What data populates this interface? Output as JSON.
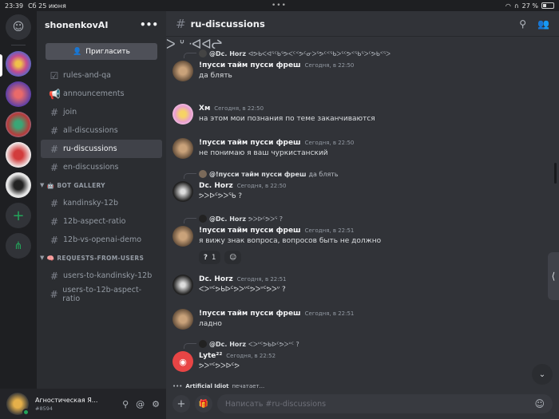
{
  "status": {
    "time": "23:39",
    "date": "Сб 25 июня",
    "battery": "27 %"
  },
  "server": {
    "name": "shonenkovAI",
    "invite_label": "Пригласить"
  },
  "channels": [
    {
      "name": "rules-and-qa",
      "icon": "rules-icon"
    },
    {
      "name": "announcements",
      "icon": "megaphone-icon"
    },
    {
      "name": "join",
      "icon": "hash-icon"
    },
    {
      "name": "all-discussions",
      "icon": "hash-icon"
    },
    {
      "name": "ru-discussions",
      "icon": "hash-icon",
      "active": true
    },
    {
      "name": "en-discussions",
      "icon": "hash-icon"
    }
  ],
  "categories": [
    {
      "name": "BOT GALLERY",
      "channels": [
        "kandinsky-12b",
        "12b-aspect-ratio",
        "12b-vs-openai-demo"
      ]
    },
    {
      "name": "REQUESTS-FROM-USERS",
      "channels": [
        "users-to-kandinsky-12b",
        "users-to-12b-aspect-ratio"
      ]
    }
  ],
  "user": {
    "name": "Агностическая Я...",
    "tag": "#8594"
  },
  "header": {
    "channel": "ru-discussions"
  },
  "messages": {
    "top_fragment": "ᐳ ᐡ ᐧᐊᐊᖠ",
    "m1": {
      "reply_name": "@Dc. Horz",
      "reply_text": "ᐊᕗᑲᐸᐊᕐᑦᑲᕐᕗᐸᑦᑉᕗᑦᓂᐳᕐᕗᑦᑉᕐᑲᐳᕐᑦᕗᑉᕐᑲᕐᐳᑦᕗᑲᑉᕐᐳ",
      "author": "!пусси тайм пусси фреш",
      "time": "Сегодня, в 22:50",
      "text": "да блять"
    },
    "m2": {
      "author": "Хм",
      "time": "Сегодня, в 22:50",
      "text": "на этом мои познания по теме  заканчиваются"
    },
    "m3": {
      "author": "!пусси тайм пусси фреш",
      "time": "Сегодня, в 22:50",
      "text": "не понимаю я ваш чуркистанский"
    },
    "m4": {
      "reply_name": "@!пусси тайм пусси фреш",
      "reply_text": "да блять",
      "author": "Dc. Horz",
      "time": "Сегодня, в 22:50",
      "text": "ᕗᐳᐅᑦᕗᐳᕐᑲ ?"
    },
    "m5": {
      "reply_name": "@Dc. Horz",
      "reply_text": "ᕗᐳᐅᑦᕗᐳᕐ ?",
      "author": "!пусси тайм пусси фреш",
      "time": "Сегодня, в 22:51",
      "text": "я вижу знак вопроса, вопросов быть не должно",
      "reaction": "?",
      "reaction_count": "1"
    },
    "m6": {
      "author": "Dc. Horz",
      "time": "Сегодня, в 22:51",
      "text": "ᐸᐳᐡᑦᕗᑲᐅᑦᕗᐳᐡᑦᕗᐳᐡᑦᕗᐳᐡ ?"
    },
    "m7": {
      "author": "!пусси тайм пусси фреш",
      "time": "Сегодня, в 22:51",
      "text": "ладно"
    },
    "m8": {
      "reply_name": "@Dc. Horz",
      "reply_text": "ᐸᐳᐡᑦᕗᑲᐅᑦᕗᐳᐡᑦ ?",
      "author": "Lyte²²",
      "time": "Сегодня, в 22:52",
      "text": "ᕗᐳᐡᑦᕗᐳᐅᑦᕗ"
    }
  },
  "typing": {
    "user": "Artificial Idiot",
    "suffix": "печатает..."
  },
  "composer": {
    "placeholder": "Написать #ru-discussions"
  },
  "colors": {
    "accent": "#5865f2",
    "online": "#23a55a",
    "bg_main": "#313338",
    "bg_sidebar": "#2b2d31"
  }
}
